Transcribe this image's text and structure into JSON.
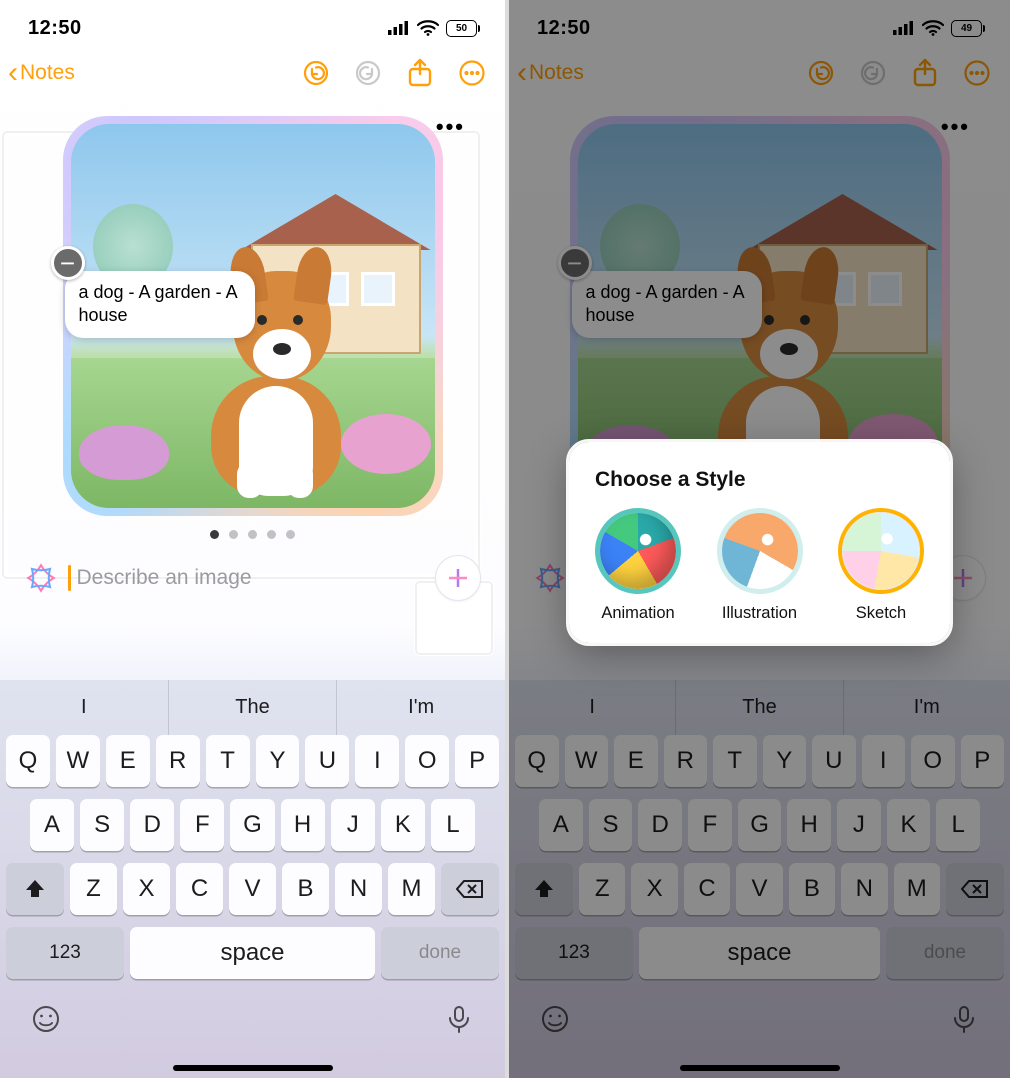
{
  "left": {
    "status": {
      "time": "12:50",
      "battery": "50",
      "icons": [
        "signal",
        "wifi",
        "battery"
      ]
    },
    "nav": {
      "back_label": "Notes",
      "buttons": [
        "undo",
        "redo",
        "share",
        "more"
      ],
      "redo_enabled": false
    },
    "generator": {
      "more_dots": "•••",
      "prompt_chip": "a dog - A garden - A house",
      "remove_glyph": "−",
      "page_count": 5,
      "page_active": 0
    },
    "prompt": {
      "placeholder": "Describe an image",
      "plus_label": "+"
    },
    "keyboard": {
      "suggestions": [
        "I",
        "The",
        "I'm"
      ],
      "row1": [
        "Q",
        "W",
        "E",
        "R",
        "T",
        "Y",
        "U",
        "I",
        "O",
        "P"
      ],
      "row2": [
        "A",
        "S",
        "D",
        "F",
        "G",
        "H",
        "J",
        "K",
        "L"
      ],
      "row3": [
        "Z",
        "X",
        "C",
        "V",
        "B",
        "N",
        "M"
      ],
      "num_label": "123",
      "space_label": "space",
      "done_label": "done"
    }
  },
  "right": {
    "status": {
      "time": "12:50",
      "battery": "49",
      "icons": [
        "signal",
        "wifi",
        "battery"
      ]
    },
    "nav": {
      "back_label": "Notes",
      "buttons": [
        "undo",
        "redo",
        "share",
        "more"
      ],
      "redo_enabled": false
    },
    "generator": {
      "more_dots": "•••",
      "prompt_chip": "a dog - A garden - A house",
      "remove_glyph": "−",
      "page_count": 5,
      "page_active": 0
    },
    "prompt": {
      "placeholder": "Describe an image",
      "plus_label": "+"
    },
    "keyboard": {
      "suggestions": [
        "I",
        "The",
        "I'm"
      ],
      "row1": [
        "Q",
        "W",
        "E",
        "R",
        "T",
        "Y",
        "U",
        "I",
        "O",
        "P"
      ],
      "row2": [
        "A",
        "S",
        "D",
        "F",
        "G",
        "H",
        "J",
        "K",
        "L"
      ],
      "row3": [
        "Z",
        "X",
        "C",
        "V",
        "B",
        "N",
        "M"
      ],
      "num_label": "123",
      "space_label": "space",
      "done_label": "done"
    },
    "style_sheet": {
      "title": "Choose a Style",
      "options": [
        {
          "id": "animation",
          "label": "Animation",
          "selected": false
        },
        {
          "id": "illustration",
          "label": "Illustration",
          "selected": false
        },
        {
          "id": "sketch",
          "label": "Sketch",
          "selected": true
        }
      ]
    }
  }
}
